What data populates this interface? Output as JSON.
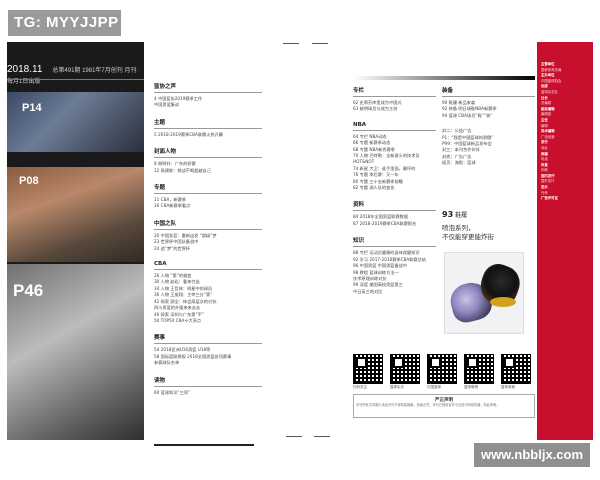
{
  "watermark": {
    "top": "TG: MYYJJPP",
    "bottom": "www.nbbljx.com"
  },
  "left_page": {
    "year": "2018.11",
    "header_small": "总第491期  1981年7月创刊  月刊·每月1日出版",
    "photo_labels": [
      "P14",
      "P08",
      "P46"
    ],
    "toc": [
      {
        "title": "篮协之声",
        "items": [
          "4 中国篮协2019赛季工作",
          "中国男篮集训"
        ]
      },
      {
        "title": "主题",
        "items": [
          "5 2018-2019赛季CBA联赛火热开幕"
        ]
      },
      {
        "title": "封面人物",
        "items": [
          "8 胡明轩：广东的骄傲",
          "12 易建联：挑战不断超越自己"
        ]
      },
      {
        "title": "专题",
        "items": [
          "11 CBA，新赛季",
          "16 CBA新赛季看点"
        ]
      },
      {
        "title": "中国之队",
        "items": [
          "20 中国女篮：重新出发 “超级”梦",
          "23 世界杯中国队备战中",
          "24 追“梦”的世界杯"
        ]
      },
      {
        "title": "CBA",
        "items": [
          "26 人物 “第”的蜕变",
          "30 人物 赵岩：看来付出",
          "34 人物 王哲林：明星中的球员",
          "36 人物 王振翔：主宰三分“第”",
          "42 探索 顾全：体会高层次的对抗",
          "   四川男篮的外援来来去去",
          "46 探索 深圳与广东第“不”",
          "50 TOP50 CBA十大亮点"
        ]
      },
      {
        "title": "赛事",
        "items": [
          "54 2018亚洲U16男篮 U18等",
          "58 国际篮联周报 2018全国男篮各项赛事",
          "   参赛球队名单"
        ]
      },
      {
        "title": "读物",
        "items": [
          "60 篮球知识“三项”"
        ]
      }
    ]
  },
  "right_page": {
    "colA": [
      {
        "title": "专栏",
        "items": [
          "62 史蒂芬库里成为中国式",
          "63 姚明球员与成为主创"
        ]
      },
      {
        "title": "NBA",
        "items": [
          "64 专栏 NBA动态",
          "66 专题 新赛季动态",
          "68 专题 NBA新秀赛季",
          "70 人物 巴特勒：全新意义的技术员",
          "   HOT&NOT",
          "74 新星 大卫：谁手里面，最坏的",
          "76 专题 季后赛：又一年",
          "80 专题 三十支新赛季前瞻",
          "82 专题 湖人队的变化"
        ]
      },
      {
        "title": "资料",
        "items": [
          "84 2018年全国男篮联赛数据",
          "87 2018-2019赛季CBA联赛报名"
        ]
      },
      {
        "title": "知识",
        "items": [
          "88 专栏 运动员健康的身体保健知识",
          "92 学习 2017-2018赛季CBA联赛总结",
          "96 中国男篮 中国男篮备战中",
          "98 教程 篮球训练方法一",
          "   技术原理训练对抗",
          "99 深度 美国高校男篮第三",
          "   中日英三地对比"
        ]
      }
    ],
    "colB": [
      {
        "title": "装备",
        "items": [
          "90 鞋履 新品来袭",
          "92 装备 明日球鞋NBA新赛季",
          "94 篮球 CBA球员“鞋”“装”"
        ]
      },
      {
        "title": "",
        "items": [
          "封二：公益广告",
          "P1：“我是中国篮球的骄傲”",
          "P99：中国篮球新品发布会",
          "封三：本刊合作伙伴",
          "封底：广告广告",
          "插页：海报：篮球"
        ]
      }
    ],
    "feature": {
      "number": "93",
      "label": "鞋履",
      "slogan_line1": "喷泡系列，",
      "slogan_line2": "不仅能穿更能炸街"
    },
    "qr_captions": [
      "扫码关注",
      "篮球杂志",
      "中国篮球",
      "篮球微博",
      "篮球商城"
    ],
    "notice": {
      "title": "严正声明",
      "body": "本刊所有文章图片未经许可不得转载摘编，违者必究。本刊已授权合作平台进行网络传播，特此声明。"
    }
  },
  "red_strip": {
    "lines": [
      "主管单位",
      "国家体育总局",
      "主办单位",
      "中国篮球协会",
      "出版",
      "篮球杂志社",
      "社长",
      "总编辑",
      "副总编辑",
      "编辑部",
      "主任",
      "编辑",
      "美术编辑",
      "广告经营",
      "发行",
      "地址",
      "邮编",
      "电话",
      "传真",
      "印刷",
      "国内发行",
      "国外发行",
      "定价",
      "刊号",
      "广告许可证"
    ]
  }
}
